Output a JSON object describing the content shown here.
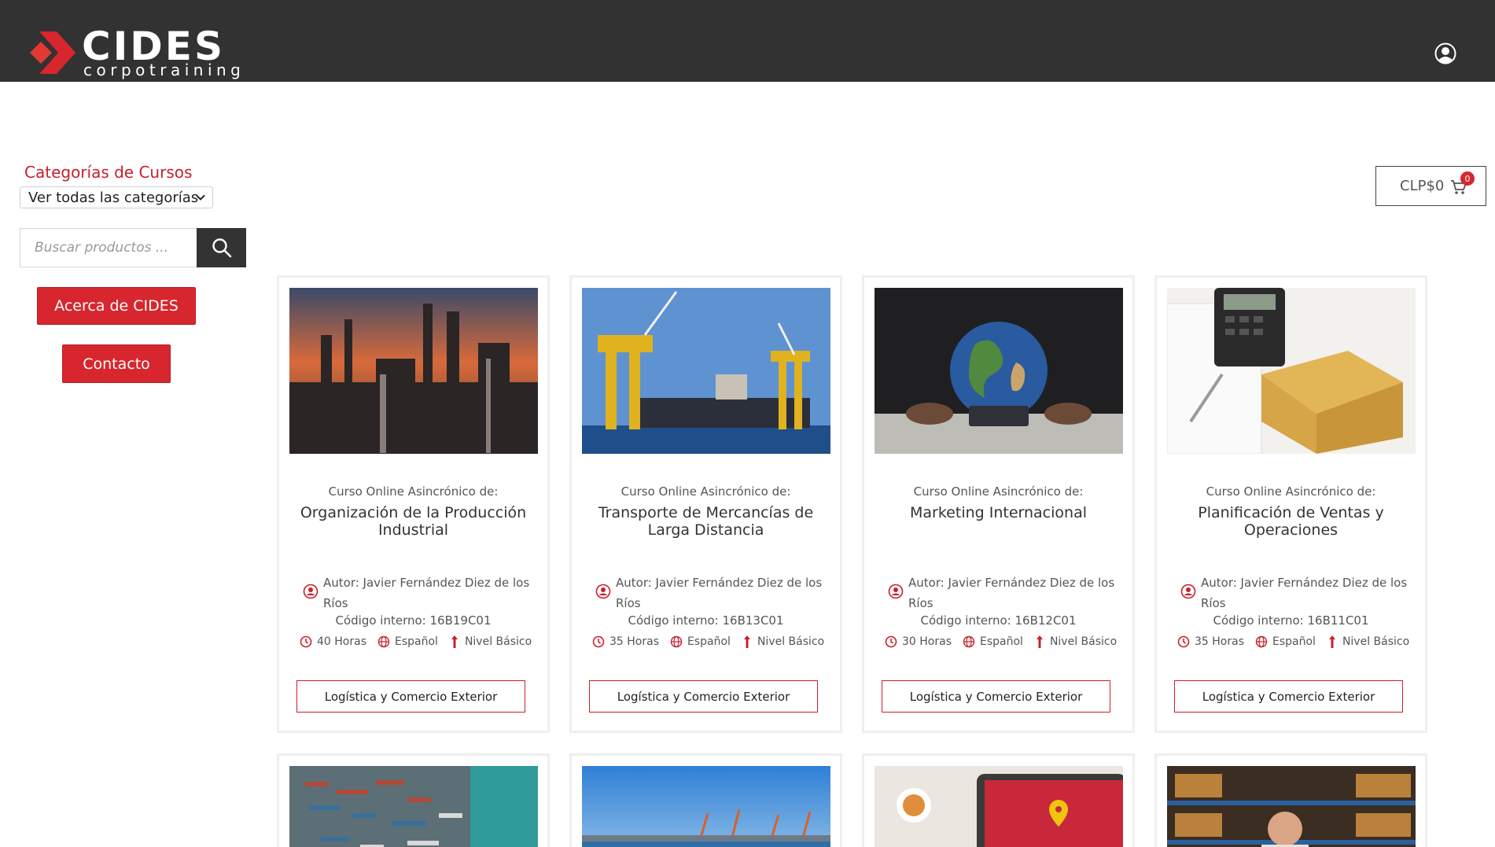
{
  "brand": {
    "name": "CIDES",
    "tagline": "corpotraining",
    "accent": "#d7262e",
    "header_bg": "#323232"
  },
  "header": {
    "account_icon": "user-circle-icon"
  },
  "sidebar": {
    "categories_title": "Categorías de Cursos",
    "category_select_value": "Ver todas las categorías",
    "search_placeholder": "Buscar productos ...",
    "about_button": "Acerca de CIDES",
    "contact_button": "Contacto"
  },
  "cart": {
    "total": "CLP$0",
    "count": "0"
  },
  "products": [
    {
      "subtitle": "Curso Online Asincrónico de:",
      "title": "Organización de la Producción Industrial",
      "author": "Autor: Javier Fernández Diez de los Ríos",
      "code": "Código interno: 16B19C01",
      "hours": "40 Horas",
      "language": "Español",
      "level": "Nivel Básico",
      "category": "Logística y Comercio Exterior",
      "image": "industrial-plant-sunset"
    },
    {
      "subtitle": "Curso Online Asincrónico de:",
      "title": "Transporte de Mercancías de Larga Distancia",
      "author": "Autor: Javier Fernández Diez de los Ríos",
      "code": "Código interno: 16B13C01",
      "hours": "35 Horas",
      "language": "Español",
      "level": "Nivel Básico",
      "category": "Logística y Comercio Exterior",
      "image": "port-cranes-ship"
    },
    {
      "subtitle": "Curso Online Asincrónico de:",
      "title": "Marketing Internacional",
      "author": "Autor: Javier Fernández Diez de los Ríos",
      "code": "Código interno: 16B12C01",
      "hours": "30 Horas",
      "language": "Español",
      "level": "Nivel Básico",
      "category": "Logística y Comercio Exterior",
      "image": "globe-hands"
    },
    {
      "subtitle": "Curso Online Asincrónico de:",
      "title": "Planificación de Ventas y Operaciones",
      "author": "Autor: Javier Fernández Diez de los Ríos",
      "code": "Código interno: 16B11C01",
      "hours": "35 Horas",
      "language": "Español",
      "level": "Nivel Básico",
      "category": "Logística y Comercio Exterior",
      "image": "calculator-boxes"
    }
  ],
  "products_row2_images": [
    "container-port-aerial",
    "harbor-cranes-sky",
    "tablet-map-pin",
    "warehouse-worker"
  ]
}
